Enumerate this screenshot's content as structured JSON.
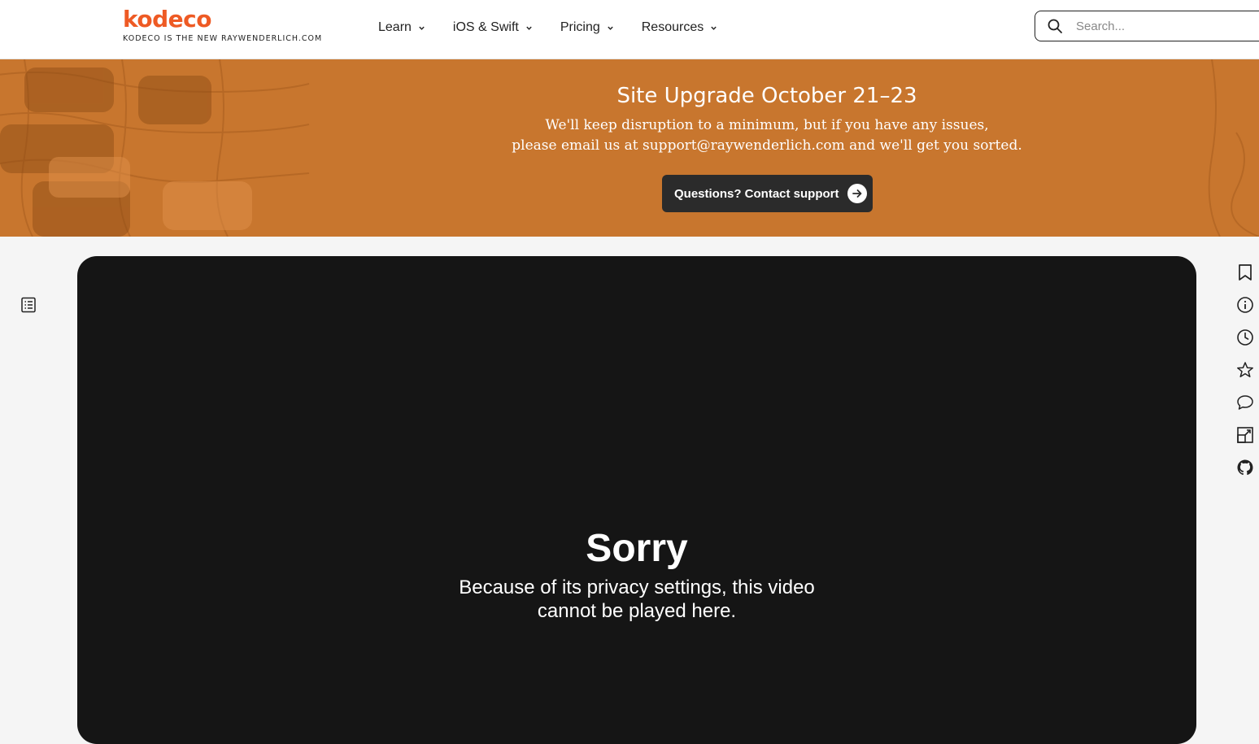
{
  "header": {
    "logo_text": "kodeco",
    "logo_tagline": "KODECO IS THE NEW RAYWENDERLICH.COM",
    "nav": [
      {
        "label": "Learn"
      },
      {
        "label": "iOS & Swift"
      },
      {
        "label": "Pricing"
      },
      {
        "label": "Resources"
      }
    ],
    "search_placeholder": "Search..."
  },
  "banner": {
    "title": "Site Upgrade October 21–23",
    "line1": "We'll keep disruption to a minimum, but if you have any issues,",
    "line2": "please email us at support@raywenderlich.com and we'll get you sorted.",
    "button_label": "Questions? Contact support"
  },
  "video": {
    "title": "Sorry",
    "message_line1": "Because of its privacy settings, this video",
    "message_line2": "cannot be played here."
  },
  "rail_icons": [
    "bookmark-icon",
    "info-icon",
    "clock-icon",
    "star-icon",
    "comment-icon",
    "external-link-icon",
    "github-icon"
  ],
  "colors": {
    "brand": "#ee5a24",
    "banner": "#c8762e",
    "video_bg": "#151515",
    "button_bg": "#2b2b2b"
  }
}
